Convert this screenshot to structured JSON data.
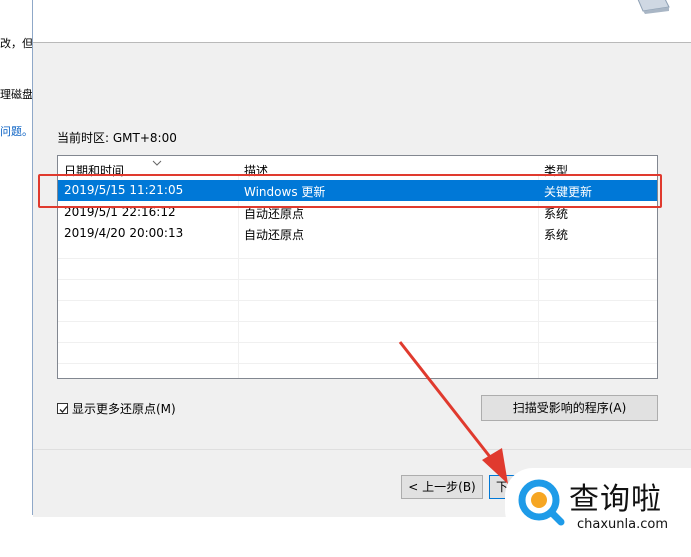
{
  "background_window": {
    "fragments": [
      "改，但",
      "理磁盘",
      "问题。"
    ]
  },
  "dialog": {
    "timezone_label": "当前时区: GMT+8:00",
    "columns": [
      "日期和时间",
      "描述",
      "类型"
    ],
    "rows": [
      {
        "datetime": "2019/5/15 11:21:05",
        "description": "Windows 更新",
        "type": "关键更新",
        "selected": true
      },
      {
        "datetime": "2019/5/1 22:16:12",
        "description": "自动还原点",
        "type": "系统",
        "selected": false
      },
      {
        "datetime": "2019/4/20 20:00:13",
        "description": "自动还原点",
        "type": "系统",
        "selected": false
      }
    ],
    "show_more_label": "显示更多还原点(M)",
    "show_more_checked": true,
    "scan_button_label": "扫描受影响的程序(A)",
    "back_button_label": "< 上一步(B)",
    "next_button_label": "下一步(N) >"
  },
  "watermark": {
    "brand_cn": "查询啦",
    "url": "chaxunla.com"
  },
  "colors": {
    "selection": "#0078d7",
    "annotation_red": "#e03a2e",
    "link_blue": "#0b62c4",
    "brand_blue": "#1e9be8"
  }
}
